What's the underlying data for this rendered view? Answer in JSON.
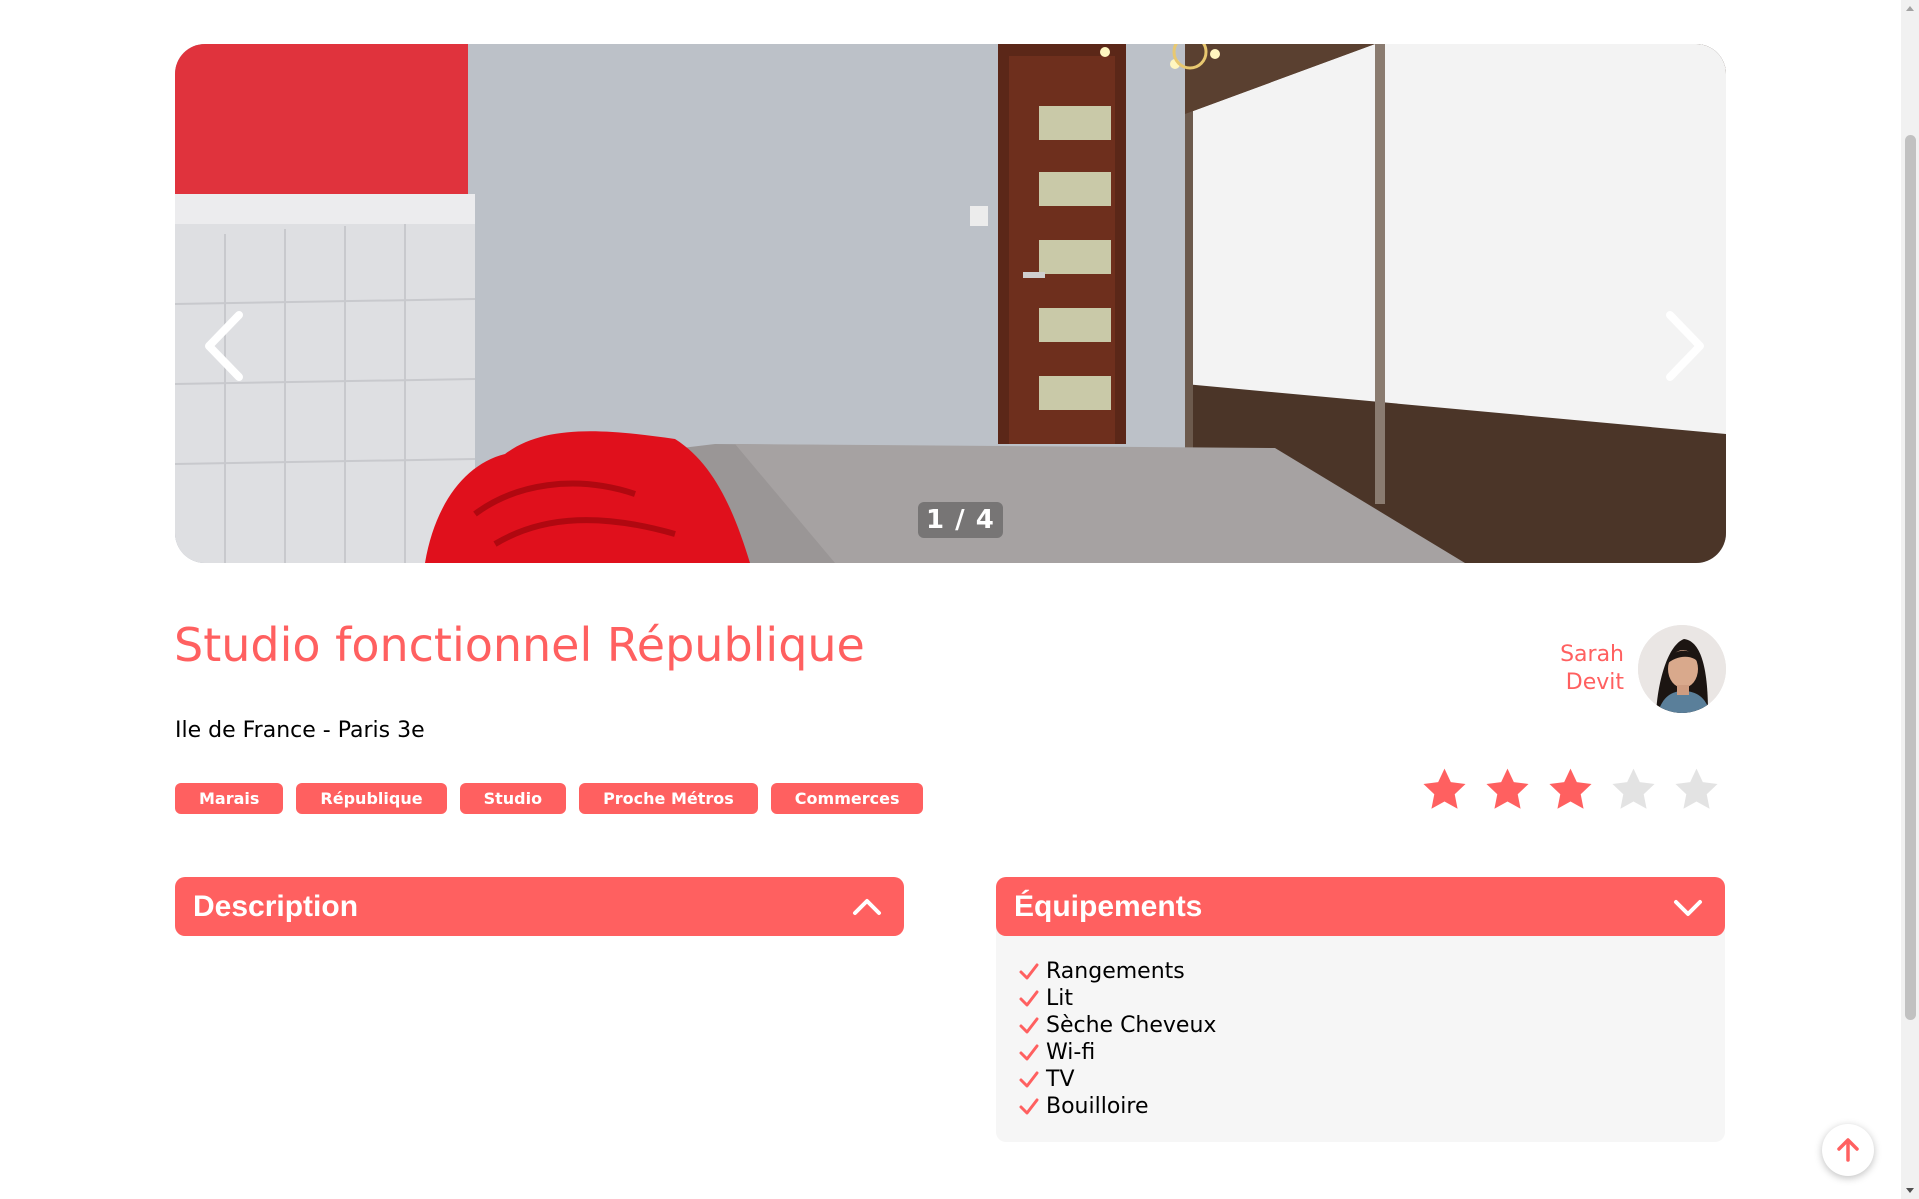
{
  "carousel": {
    "counter": "1 / 4",
    "current": 1,
    "total": 4
  },
  "listing": {
    "title": "Studio fonctionnel République",
    "location": "Ile de France - Paris 3e",
    "tags": [
      "Marais",
      "République",
      "Studio",
      "Proche Métros",
      "Commerces"
    ],
    "rating": 3,
    "rating_max": 5
  },
  "host": {
    "first_name": "Sarah",
    "last_name": "Devit"
  },
  "description": {
    "title": "Description",
    "expanded": false
  },
  "equipments": {
    "title": "Équipements",
    "expanded": true,
    "items": [
      "Rangements",
      "Lit",
      "Sèche Cheveux",
      "Wi-fi",
      "TV",
      "Bouilloire"
    ]
  },
  "colors": {
    "accent": "#ff6060",
    "star_empty": "#e3e3e3",
    "panel_bg": "#f6f6f6"
  },
  "icons": {
    "prev": "chevron-left-icon",
    "next": "chevron-right-icon",
    "star": "star-icon",
    "check": "check-icon",
    "collapse_open": "chevron-up-icon",
    "collapse_closed": "chevron-down-icon",
    "scroll_top": "arrow-up-icon"
  }
}
